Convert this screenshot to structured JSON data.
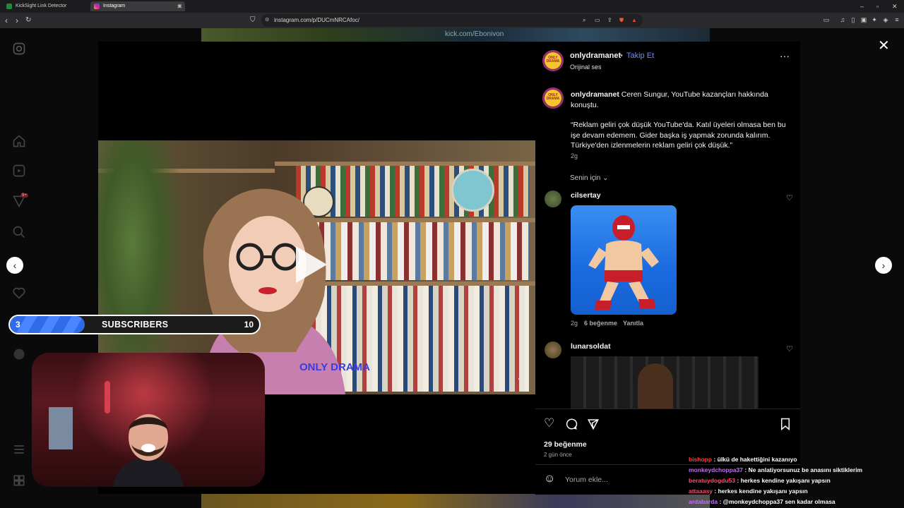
{
  "browser": {
    "tabs": [
      {
        "label": "KickSight Link Detector",
        "active": false
      },
      {
        "label": "Instagram",
        "active": true
      }
    ],
    "url": "instagram.com/p/DUCmNRCAfoc/"
  },
  "background": {
    "top_text": "kick.com/Ebonivon"
  },
  "left_nav": {
    "icons": [
      "instagram-icon",
      "home-icon",
      "reels-icon",
      "explore-icon",
      "search-icon",
      "heart-icon",
      "profile-icon",
      "menu-icon",
      "grid-icon"
    ],
    "notification_badge": "9+"
  },
  "post": {
    "author": "onlydramanet",
    "follow_label": "Takip Et",
    "audio": "Orijinal ses",
    "avatar_text": "ONLY DRAMA",
    "caption_user": "onlydramanet",
    "caption_text": "Ceren Sungur, YouTube kazançları hakkında konuştu.",
    "quote": "“Reklam geliri çok düşük YouTube'da. Katıl üyeleri olmasa ben bu işe devam edemem. Gider başka iş yapmak zorunda kalırım. Türkiye'den izlenmelerin reklam geliri çok düşük.”",
    "caption_time": "2g",
    "sort_label": "Senin için",
    "likes": "29 beğenme",
    "date": "2 gün önce",
    "comment_placeholder": "Yorum ekle...",
    "video_watermark": "ONLY DRAMA"
  },
  "comments": [
    {
      "user": "cilsertay",
      "time": "2g",
      "likes": "6 beğenme",
      "reply": "Yanıtla"
    },
    {
      "user": "lunarsoldat"
    }
  ],
  "overlay": {
    "subs_current": "3",
    "subs_label": "SUBSCRIBERS",
    "subs_goal": "10",
    "subs_progress": 0.3
  },
  "chat": [
    {
      "user": "bishopp",
      "color": "#ff3b3b",
      "msg": "ülkü de hakettiğini kazanıyo"
    },
    {
      "user": "monkeydchoppa37",
      "color": "#c76bff",
      "msg": "Ne anlatiyorsunuz be anasını siktiklerim"
    },
    {
      "user": "beratuydogdu53",
      "color": "#ff4d6d",
      "msg": "herkes kendine yakışanı yapsın"
    },
    {
      "user": "attaaasy",
      "color": "#ff4d6d",
      "msg": "herkes kendine yakışanı yapsın"
    },
    {
      "user": "ardabarda",
      "color": "#c76bff",
      "msg": "@monkeydchoppa37 sen kadar olmasa"
    }
  ],
  "colors": {
    "accent": "#6d8cff",
    "bar": "#2f6ae8"
  }
}
